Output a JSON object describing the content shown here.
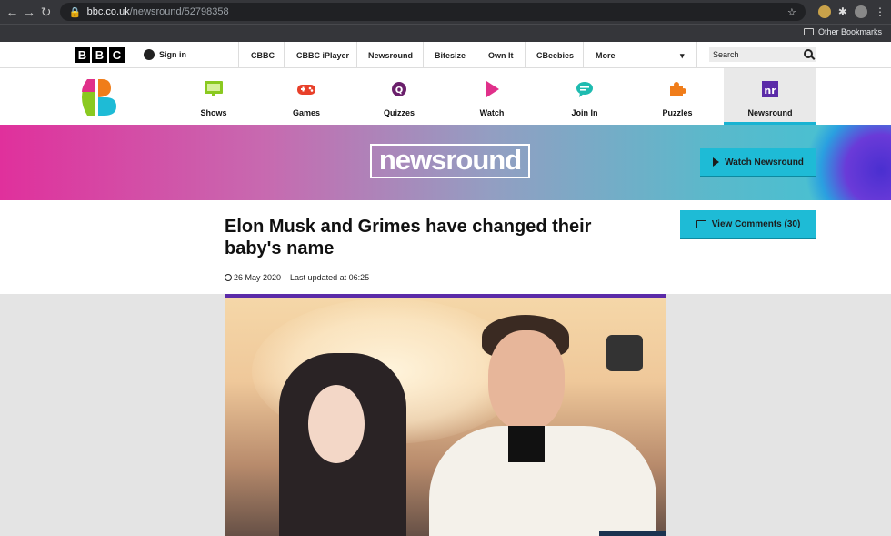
{
  "browser": {
    "url_host": "bbc.co.uk",
    "url_path": "/newsround/52798358",
    "bookmarks_label": "Other Bookmarks"
  },
  "bbc_bar": {
    "logo_letters": [
      "B",
      "B",
      "C"
    ],
    "sign_in": "Sign in",
    "nav": [
      "CBBC",
      "CBBC iPlayer",
      "Newsround",
      "Bitesize",
      "Own It",
      "CBeebies",
      "More"
    ],
    "more_chevron": "▾",
    "search_placeholder": "Search"
  },
  "cbbc_nav": {
    "items": [
      {
        "label": "Shows",
        "icon": "tv-icon",
        "color": "#8ac920"
      },
      {
        "label": "Games",
        "icon": "gamepad-icon",
        "color": "#e8402a"
      },
      {
        "label": "Quizzes",
        "icon": "quiz-icon",
        "color": "#6a1f6b"
      },
      {
        "label": "Watch",
        "icon": "play-icon",
        "color": "#e0308a"
      },
      {
        "label": "Join In",
        "icon": "chat-icon",
        "color": "#1ebbb0"
      },
      {
        "label": "Puzzles",
        "icon": "puzzle-icon",
        "color": "#f07d1a"
      },
      {
        "label": "Newsround",
        "icon": "newsround-icon",
        "color": "#5b2ba8",
        "active": true
      }
    ]
  },
  "banner": {
    "logo_text": "newsround",
    "watch_button": "Watch Newsround"
  },
  "article": {
    "headline": "Elon Musk and Grimes have changed their baby's name",
    "date": "26 May 2020",
    "updated": "Last updated at 06:25",
    "comments_button": "View Comments (30)"
  },
  "colors": {
    "accent": "#1ebbd6",
    "rule": "#5b2ba8"
  }
}
